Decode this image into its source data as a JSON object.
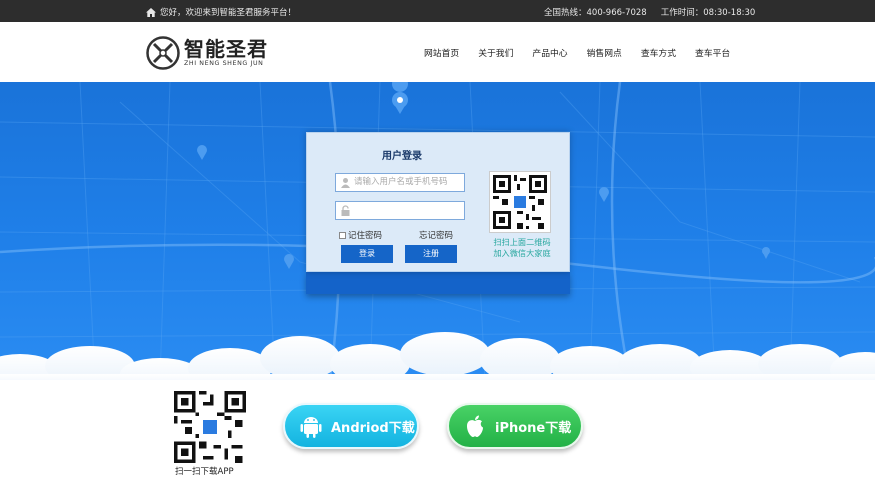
{
  "topbar": {
    "welcome": "您好，欢迎来到智能圣君服务平台！",
    "hotline": "全国热线：400-966-7028",
    "hours": "工作时间：08:30-18:30"
  },
  "logo": {
    "cn": "智能圣君",
    "en": "ZHI NENG SHENG JUN"
  },
  "nav": [
    "网站首页",
    "关于我们",
    "产品中心",
    "销售网点",
    "查车方式",
    "查车平台"
  ],
  "login": {
    "title": "用户登录",
    "username_placeholder": "请输入用户名或手机号码",
    "password_value": "",
    "remember_label": "记住密码",
    "forgot_label": "忘记密码",
    "login_button": "登录",
    "register_button": "注册",
    "qr_caption_1": "扫扫上面二维码",
    "qr_caption_2": "加入微信大家庭"
  },
  "download": {
    "app_qr_caption": "扫一扫下载APP",
    "android_label": "Andriod下载",
    "iphone_label": "iPhone下载"
  },
  "colors": {
    "hero": "#1f7fe8",
    "button": "#1565c8",
    "android": "#13b3e0",
    "iphone": "#22b146"
  }
}
